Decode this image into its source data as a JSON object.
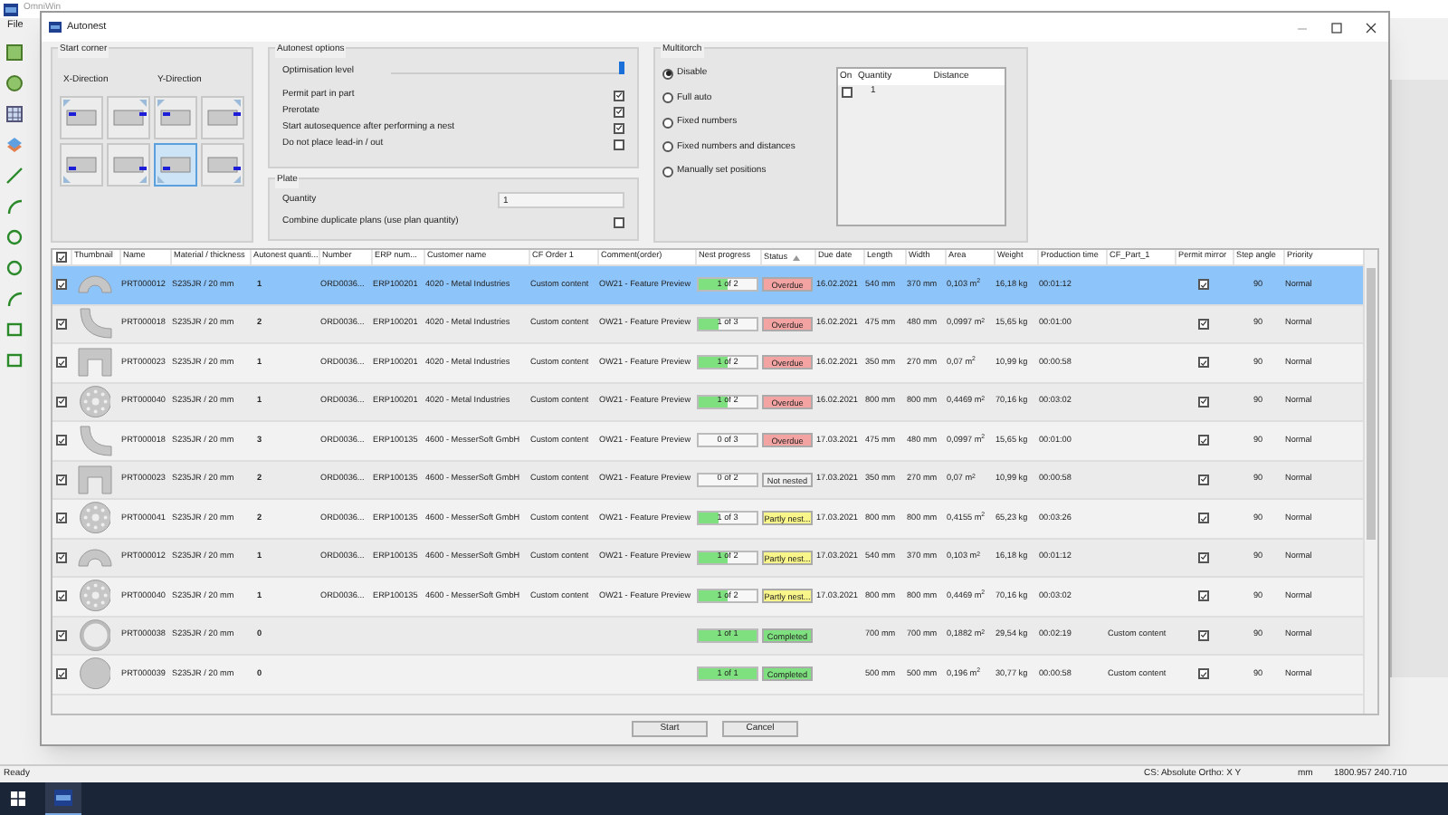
{
  "app": {
    "title": "OmniWin",
    "menu": [
      "File"
    ],
    "status_bar": {
      "message": "Ready",
      "coordinate_system": "CS: Absolute Ortho: X Y",
      "unit": "mm",
      "coordinates": "1800.957  240.710"
    }
  },
  "dialog": {
    "title": "Autonest",
    "start_corner": {
      "title": "Start corner",
      "x_label": "X-Direction",
      "y_label": "Y-Direction",
      "corners": [
        {
          "selected": false
        },
        {
          "selected": false
        },
        {
          "selected": false
        },
        {
          "selected": false
        },
        {
          "selected": false
        },
        {
          "selected": false
        },
        {
          "selected": true
        },
        {
          "selected": false
        }
      ]
    },
    "autonest_options": {
      "title": "Autonest options",
      "optimisation": {
        "label": "Optimisation level",
        "level": 1
      },
      "options": [
        {
          "label": "Permit part in part",
          "checked": true
        },
        {
          "label": "Prerotate",
          "checked": true
        },
        {
          "label": "Start autosequence after performing a nest",
          "checked": true
        },
        {
          "label": "Do not place lead-in / out",
          "checked": false
        }
      ]
    },
    "plate": {
      "title": "Plate",
      "quantity_label": "Quantity",
      "quantity": "1",
      "combine_label": "Combine duplicate plans (use plan quantity)",
      "combine_checked": false
    },
    "multitorch": {
      "title": "Multitorch",
      "modes": [
        {
          "label": "Disable",
          "selected": true
        },
        {
          "label": "Full auto",
          "selected": false
        },
        {
          "label": "Fixed numbers",
          "selected": false
        },
        {
          "label": "Fixed numbers and distances",
          "selected": false
        },
        {
          "label": "Manually set positions",
          "selected": false
        }
      ],
      "table": {
        "columns": [
          "On",
          "Quantity",
          "Distance"
        ],
        "rows": [
          {
            "on": false,
            "quantity": "1"
          }
        ]
      }
    },
    "table": {
      "all_checked": true,
      "columns": [
        "Thumbnail",
        "Name",
        "Material / thickness",
        "Autonest quanti...",
        "Number",
        "ERP num...",
        "Customer name",
        "CF Order 1",
        "Comment(order)",
        "Nest progress",
        "Status",
        "Due date",
        "Length",
        "Width",
        "Area",
        "Weight",
        "Production time",
        "CF_Part_1",
        "Permit mirror",
        "Step angle",
        "Priority"
      ],
      "rows": [
        {
          "kind": "arch",
          "checked": true,
          "selected": true,
          "name": "PRT000012",
          "material": "S235JR / 20 mm",
          "quantity": "1",
          "number": "ORD0036...",
          "erp": "ERP100201",
          "customer": "4020 - Metal Industries",
          "cf_order_1": "Custom content",
          "comment": "OW21 - Feature Preview",
          "progress": {
            "text": "1 of 2",
            "level": 0.5
          },
          "status": {
            "text": "Overdue",
            "color": "#f4a3a3"
          },
          "due_date": "16.02.2021",
          "length": "540 mm",
          "width": "370 mm",
          "area": "0,103 m$^{2}$",
          "weight": "16,18 kg",
          "production_time": "00:01:12",
          "permit_mirror": true,
          "step_angle": "90",
          "priority": "Normal"
        },
        {
          "kind": "bend",
          "checked": true,
          "selected": false,
          "name": "PRT000018",
          "material": "S235JR / 20 mm",
          "quantity": "2",
          "number": "ORD0036...",
          "erp": "ERP100201",
          "customer": "4020 - Metal Industries",
          "cf_order_1": "Custom content",
          "comment": "OW21 - Feature Preview",
          "progress": {
            "text": "1 of 3",
            "level": 0.33
          },
          "status": {
            "text": "Overdue",
            "color": "#f4a3a3"
          },
          "due_date": "16.02.2021",
          "length": "475 mm",
          "width": "480 mm",
          "area": "0,0997 m$^{2}$",
          "weight": "15,65 kg",
          "production_time": "00:01:00",
          "permit_mirror": true,
          "step_angle": "90",
          "priority": "Normal"
        },
        {
          "kind": "channel",
          "checked": true,
          "selected": false,
          "name": "PRT000023",
          "material": "S235JR / 20 mm",
          "quantity": "1",
          "number": "ORD0036...",
          "erp": "ERP100201",
          "customer": "4020 - Metal Industries",
          "cf_order_1": "Custom content",
          "comment": "OW21 - Feature Preview",
          "progress": {
            "text": "1 of 2",
            "level": 0.5
          },
          "status": {
            "text": "Overdue",
            "color": "#f4a3a3"
          },
          "due_date": "16.02.2021",
          "length": "350 mm",
          "width": "270 mm",
          "area": "0,07 m$^{2}$",
          "weight": "10,99 kg",
          "production_time": "00:00:58",
          "permit_mirror": true,
          "step_angle": "90",
          "priority": "Normal"
        },
        {
          "kind": "flange",
          "checked": true,
          "selected": false,
          "name": "PRT000040",
          "material": "S235JR / 20 mm",
          "quantity": "1",
          "number": "ORD0036...",
          "erp": "ERP100201",
          "customer": "4020 - Metal Industries",
          "cf_order_1": "Custom content",
          "comment": "OW21 - Feature Preview",
          "progress": {
            "text": "1 of 2",
            "level": 0.5
          },
          "status": {
            "text": "Overdue",
            "color": "#f4a3a3"
          },
          "due_date": "16.02.2021",
          "length": "800 mm",
          "width": "800 mm",
          "area": "0,4469 m$^{2}$",
          "weight": "70,16 kg",
          "production_time": "00:03:02",
          "permit_mirror": true,
          "step_angle": "90",
          "priority": "Normal"
        },
        {
          "kind": "bend",
          "checked": true,
          "selected": false,
          "name": "PRT000018",
          "material": "S235JR / 20 mm",
          "quantity": "3",
          "number": "ORD0036...",
          "erp": "ERP100135",
          "customer": "4600 - MesserSoft GmbH",
          "cf_order_1": "Custom content",
          "comment": "OW21 - Feature Preview",
          "progress": {
            "text": "0 of 3",
            "level": 0
          },
          "status": {
            "text": "Overdue",
            "color": "#f4a3a3"
          },
          "due_date": "17.03.2021",
          "length": "475 mm",
          "width": "480 mm",
          "area": "0,0997 m$^{2}$",
          "weight": "15,65 kg",
          "production_time": "00:01:00",
          "permit_mirror": true,
          "step_angle": "90",
          "priority": "Normal"
        },
        {
          "kind": "channel",
          "checked": true,
          "selected": false,
          "name": "PRT000023",
          "material": "S235JR / 20 mm",
          "quantity": "2",
          "number": "ORD0036...",
          "erp": "ERP100135",
          "customer": "4600 - MesserSoft GmbH",
          "cf_order_1": "Custom content",
          "comment": "OW21 - Feature Preview",
          "progress": {
            "text": "0 of 2",
            "level": 0
          },
          "status": {
            "text": "Not nested",
            "color": "#f0f0f0"
          },
          "due_date": "17.03.2021",
          "length": "350 mm",
          "width": "270 mm",
          "area": "0,07 m$^{2}$",
          "weight": "10,99 kg",
          "production_time": "00:00:58",
          "permit_mirror": true,
          "step_angle": "90",
          "priority": "Normal"
        },
        {
          "kind": "flange",
          "checked": true,
          "selected": false,
          "name": "PRT000041",
          "material": "S235JR / 20 mm",
          "quantity": "2",
          "number": "ORD0036...",
          "erp": "ERP100135",
          "customer": "4600 - MesserSoft GmbH",
          "cf_order_1": "Custom content",
          "comment": "OW21 - Feature Preview",
          "progress": {
            "text": "1 of 3",
            "level": 0.33
          },
          "status": {
            "text": "Partly nest...",
            "color": "#f8f58a"
          },
          "due_date": "17.03.2021",
          "length": "800 mm",
          "width": "800 mm",
          "area": "0,4155 m$^{2}$",
          "weight": "65,23 kg",
          "production_time": "00:03:26",
          "permit_mirror": true,
          "step_angle": "90",
          "priority": "Normal"
        },
        {
          "kind": "arch",
          "checked": true,
          "selected": false,
          "name": "PRT000012",
          "material": "S235JR / 20 mm",
          "quantity": "1",
          "number": "ORD0036...",
          "erp": "ERP100135",
          "customer": "4600 - MesserSoft GmbH",
          "cf_order_1": "Custom content",
          "comment": "OW21 - Feature Preview",
          "progress": {
            "text": "1 of 2",
            "level": 0.5
          },
          "status": {
            "text": "Partly nest...",
            "color": "#f8f58a"
          },
          "due_date": "17.03.2021",
          "length": "540 mm",
          "width": "370 mm",
          "area": "0,103 m$^{2}$",
          "weight": "16,18 kg",
          "production_time": "00:01:12",
          "permit_mirror": true,
          "step_angle": "90",
          "priority": "Normal"
        },
        {
          "kind": "flange",
          "checked": true,
          "selected": false,
          "name": "PRT000040",
          "material": "S235JR / 20 mm",
          "quantity": "1",
          "number": "ORD0036...",
          "erp": "ERP100135",
          "customer": "4600 - MesserSoft GmbH",
          "cf_order_1": "Custom content",
          "comment": "OW21 - Feature Preview",
          "progress": {
            "text": "1 of 2",
            "level": 0.5
          },
          "status": {
            "text": "Partly nest...",
            "color": "#f8f58a"
          },
          "due_date": "17.03.2021",
          "length": "800 mm",
          "width": "800 mm",
          "area": "0,4469 m$^{2}$",
          "weight": "70,16 kg",
          "production_time": "00:03:02",
          "permit_mirror": true,
          "step_angle": "90",
          "priority": "Normal"
        },
        {
          "kind": "ring",
          "checked": true,
          "selected": false,
          "name": "PRT000038",
          "material": "S235JR / 20 mm",
          "quantity": "0",
          "progress": {
            "text": "1 of 1",
            "level": 1
          },
          "status": {
            "text": "Completed",
            "color": "#7fe07f"
          },
          "length": "700 mm",
          "width": "700 mm",
          "area": "0,1882 m$^{2}$",
          "weight": "29,54 kg",
          "production_time": "00:02:19",
          "cf_part_1": "Custom content",
          "permit_mirror": true,
          "step_angle": "90",
          "priority": "Normal"
        },
        {
          "kind": "disc",
          "checked": true,
          "selected": false,
          "name": "PRT000039",
          "material": "S235JR / 20 mm",
          "quantity": "0",
          "progress": {
            "text": "1 of 1",
            "level": 1
          },
          "status": {
            "text": "Completed",
            "color": "#7fe07f"
          },
          "length": "500 mm",
          "width": "500 mm",
          "area": "0,196 m$^{2}$",
          "weight": "30,77 kg",
          "production_time": "00:00:58",
          "cf_part_1": "Custom content",
          "permit_mirror": true,
          "step_angle": "90",
          "priority": "Normal"
        }
      ]
    },
    "buttons": [
      "Start",
      "Cancel"
    ]
  }
}
